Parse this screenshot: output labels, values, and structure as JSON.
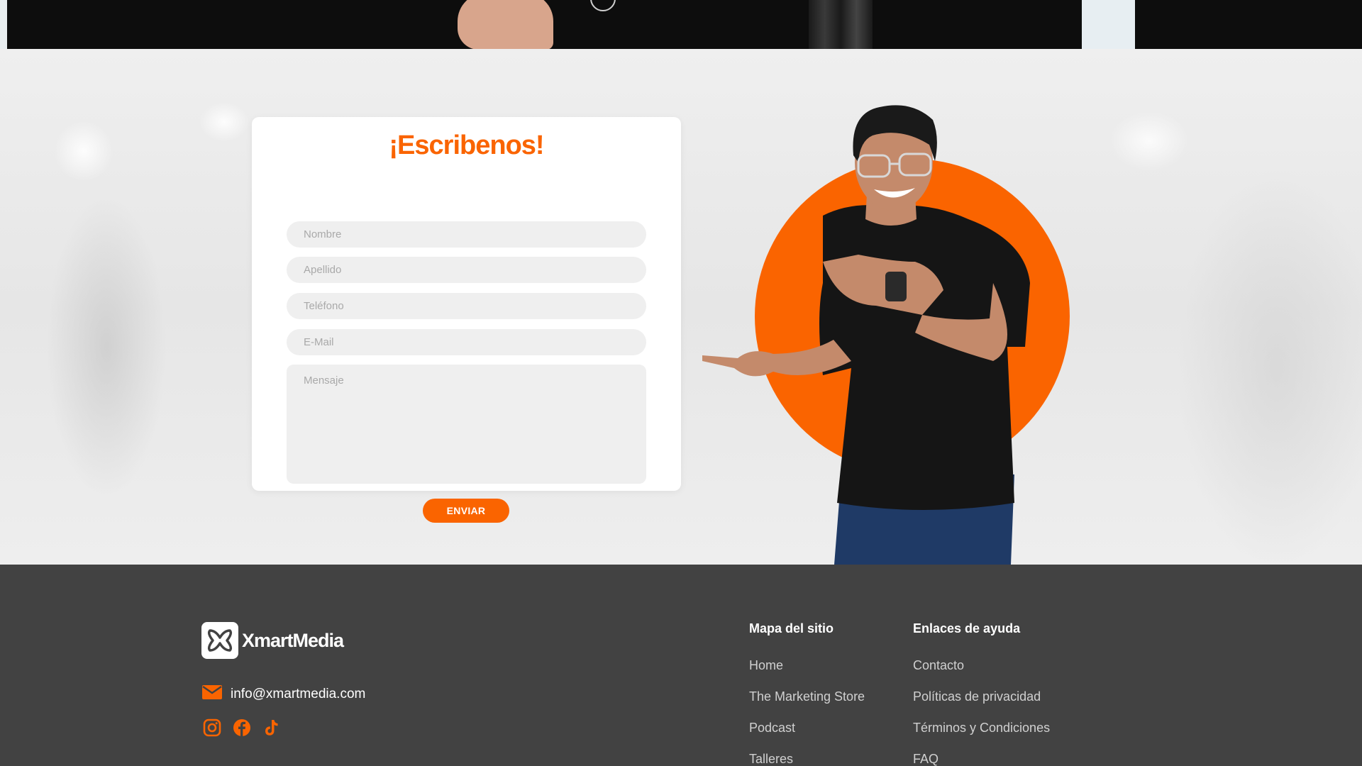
{
  "form": {
    "title": "¡Escribenos!",
    "fields": {
      "nombre": "Nombre",
      "apellido": "Apellido",
      "telefono": "Teléfono",
      "email": "E-Mail",
      "mensaje": "Mensaje"
    },
    "submit_label": "ENVIAR"
  },
  "footer": {
    "brand_name": "XmartMedia",
    "email": "info@xmartmedia.com",
    "social": [
      "instagram-icon",
      "facebook-icon",
      "tiktok-icon"
    ],
    "columns": [
      {
        "title": "Mapa del sitio",
        "links": [
          "Home",
          "The Marketing Store",
          "Podcast",
          "Talleres"
        ]
      },
      {
        "title": "Enlaces de ayuda",
        "links": [
          "Contacto",
          "Políticas de privacidad",
          "Términos y Condiciones",
          "FAQ"
        ]
      }
    ]
  },
  "colors": {
    "accent": "#fa6400",
    "footer_bg": "#424242",
    "field_bg": "#efefef"
  }
}
